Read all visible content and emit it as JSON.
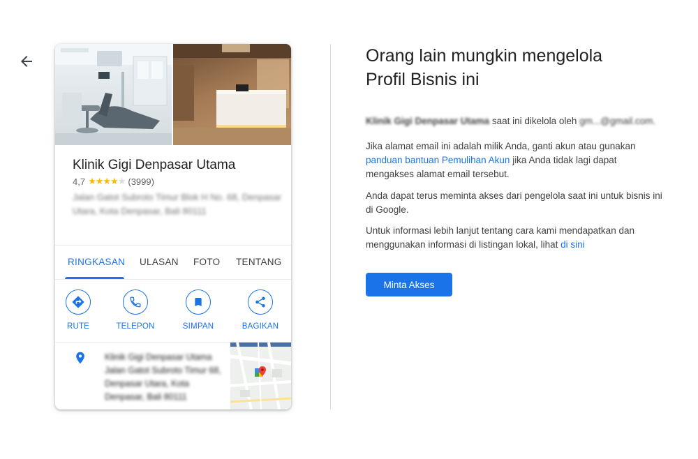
{
  "colors": {
    "accent": "#1a73e8",
    "text": "#202124",
    "muted": "#5f6368",
    "star": "#fbbc04"
  },
  "nav": {
    "back_icon": "arrow-left-icon"
  },
  "card": {
    "business_name": "Klinik Gigi Denpasar Utama",
    "rating": "4,7",
    "rating_stars": 4,
    "review_count": "(3999)",
    "address_blurred": "Jalan Gatot Subroto Timur Blok H No. 68, Denpasar Utara, Kota Denpasar, Bali 80111",
    "tabs": [
      {
        "label": "RINGKASAN",
        "active": true
      },
      {
        "label": "ULASAN",
        "active": false
      },
      {
        "label": "FOTO",
        "active": false
      },
      {
        "label": "TENTANG",
        "active": false
      }
    ],
    "actions": [
      {
        "label": "RUTE",
        "icon": "directions-icon"
      },
      {
        "label": "TELEPON",
        "icon": "phone-icon"
      },
      {
        "label": "SIMPAN",
        "icon": "bookmark-icon"
      },
      {
        "label": "BAGIKAN",
        "icon": "share-icon"
      }
    ],
    "place_blurred": "Klinik Gigi Denpasar Utama Jalan Gatot Subroto Timur 68, Denpasar Utara, Kota Denpasar, Bali 80111",
    "pin_icon": "location-pin-icon"
  },
  "right": {
    "heading_line1": "Orang lain mungkin mengelola",
    "heading_line2": "Profil Bisnis ini",
    "p1_business": "Klinik Gigi Denpasar Utama",
    "p1_text": " saat ini dikelola oleh ",
    "p1_email": "gm...@gmail.com.",
    "p2_before": "Jika alamat email ini adalah milik Anda, ganti akun atau gunakan ",
    "p2_link": "panduan bantuan Pemulihan Akun",
    "p2_after": " jika Anda tidak lagi dapat mengakses alamat email tersebut.",
    "p3": "Anda dapat terus meminta akses dari pengelola saat ini untuk bisnis ini di Google.",
    "p4_before": "Untuk informasi lebih lanjut tentang cara kami mendapatkan dan menggunakan informasi di listingan lokal, lihat ",
    "p4_link": "di sini",
    "cta_label": "Minta Akses"
  }
}
